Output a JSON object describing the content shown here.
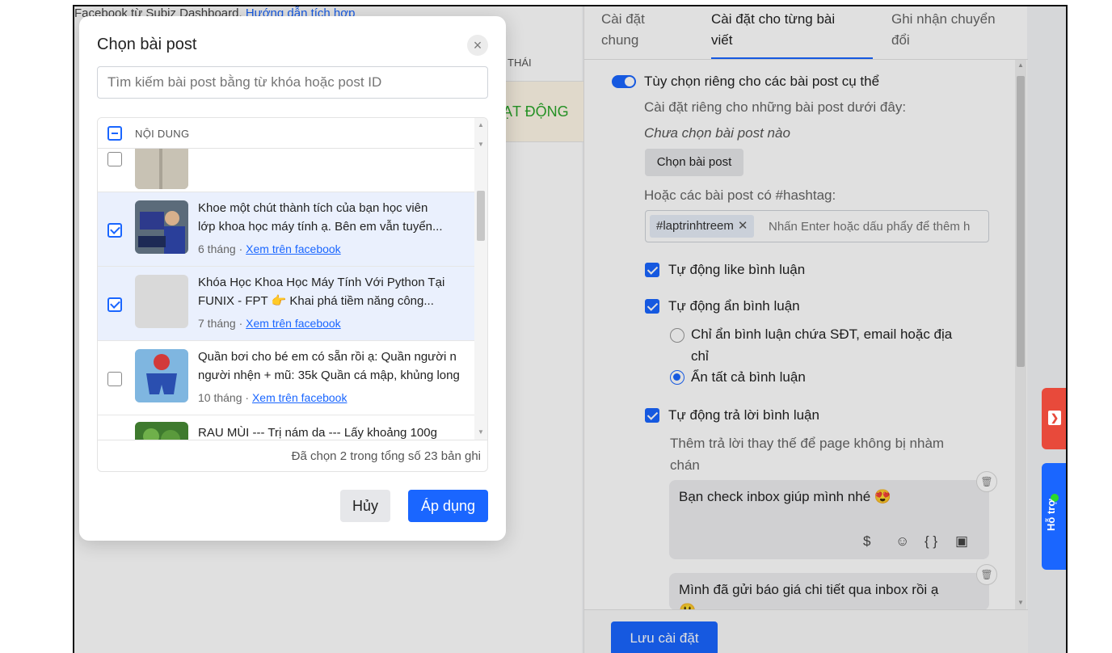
{
  "background": {
    "topline_text": "Facebook từ Subiz Dashboard.",
    "topline_link": "Hướng dẫn tích hợp",
    "status_header": "THÁI",
    "status_value": "ẠT ĐỘNG"
  },
  "settings": {
    "tabs": [
      {
        "label_line1": "Cài đặt",
        "label_line2": "chung"
      },
      {
        "label_line1": "Cài đặt cho từng bài",
        "label_line2": "viết"
      },
      {
        "label_line1": "Ghi nhận chuyển",
        "label_line2": "đổi"
      }
    ],
    "toggle_label": "Tùy chọn riêng cho các bài post cụ thể",
    "specific_posts_label": "Cài đặt riêng cho những bài post dưới đây:",
    "no_post_selected": "Chưa chọn bài post nào",
    "choose_post_button": "Chọn bài post",
    "hashtag_label": "Hoặc các bài post có #hashtag:",
    "hashtag_tag": "#laptrinhtreem",
    "hashtag_placeholder": "Nhấn Enter hoặc dấu phẩy để thêm h",
    "auto_like": "Tự động like bình luận",
    "auto_hide": "Tự động ẩn bình luận",
    "hide_option_1_line1": "Chỉ ẩn bình luận chứa SĐT, email hoặc địa",
    "hide_option_1_line2": "chỉ",
    "hide_option_2": "Ẩn tất cả bình luận",
    "auto_reply": "Tự động trả lời bình luận",
    "reply_hint_line1": "Thêm trả lời thay thế để page không bị nhàm",
    "reply_hint_line2": "chán",
    "reply_1": "Bạn check inbox giúp mình nhé 😍",
    "reply_2_line1": "Mình đã gửi báo giá chi tiết qua inbox rồi ạ",
    "reply_2_line2": "😃",
    "save_button": "Lưu cài đặt"
  },
  "modal": {
    "title": "Chọn bài post",
    "search_placeholder": "Tìm kiếm bài post bằng từ khóa hoặc post ID",
    "column_header": "NỘI DUNG",
    "rows": [
      {
        "line1": "Khoe một chút thành tích của bạn học viên",
        "line2": "lớp khoa học máy tính ạ. Bên em vẫn tuyển...",
        "age": "6 tháng",
        "link": "Xem trên facebook",
        "selected": true
      },
      {
        "line1": "Khóa Học Khoa Học Máy Tính Với Python Tại",
        "line2": "FUNIX - FPT 👉 Khai phá tiềm năng công...",
        "age": "7 tháng",
        "link": "Xem trên facebook",
        "selected": true
      },
      {
        "line1": "Quần bơi cho bé em có sẵn rồi ạ: Quần người n",
        "line2": "người nhện + mũ: 35k Quần cá mập, khủng long",
        "age": "10 tháng",
        "link": "Xem trên facebook",
        "selected": false
      },
      {
        "line1": "RAU MÙI --- Trị nám da --- Lấy khoảng 100g",
        "line2": "",
        "age": "",
        "link": "",
        "selected": false
      }
    ],
    "meta_separator": "·",
    "footer": "Đã chọn 2 trong tổng số 23 bản ghi",
    "cancel_button": "Hủy",
    "apply_button": "Áp dụng"
  },
  "side_widgets": {
    "support_label": "Hỗ trợ"
  },
  "colors": {
    "accent": "#1a66ff",
    "selected_row": "#eaf0fd",
    "status_green": "#2aa52a",
    "support_red": "#e84a3b"
  }
}
